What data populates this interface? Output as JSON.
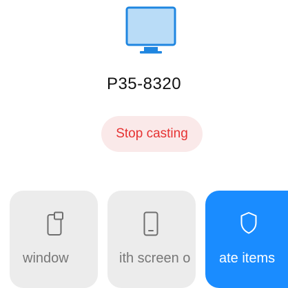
{
  "device": {
    "name": "P35-8320",
    "icon": "monitor-icon"
  },
  "cast": {
    "stop_label": "Stop casting",
    "stop_text_color": "#e63232",
    "stop_bg_color": "#fae9e9"
  },
  "actions": [
    {
      "label": "window",
      "icon": "small-window-icon",
      "state": "inactive"
    },
    {
      "label": "ith screen o",
      "icon": "phone-icon",
      "state": "inactive"
    },
    {
      "label": "ate items",
      "icon": "shield-icon",
      "state": "active",
      "color": "#1a8cff"
    }
  ]
}
